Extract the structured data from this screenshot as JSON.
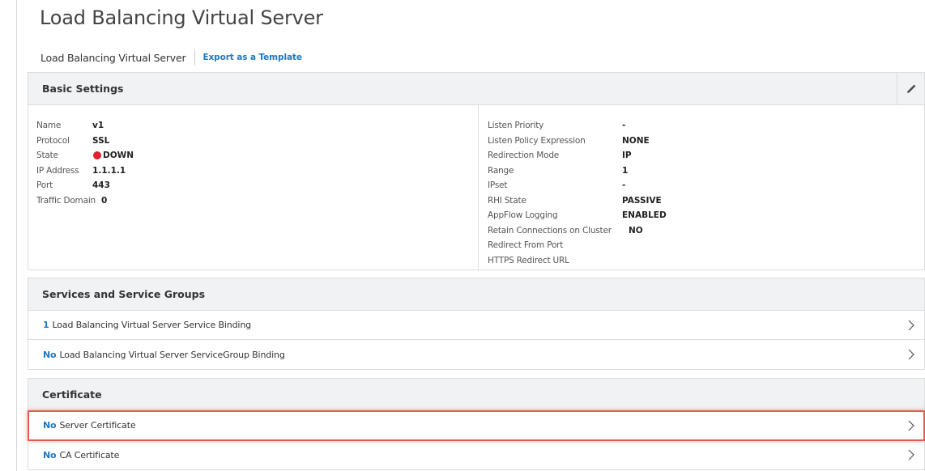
{
  "page": {
    "title": "Load Balancing Virtual Server"
  },
  "subheader": {
    "title": "Load Balancing Virtual Server",
    "export_link": "Export as a Template"
  },
  "basic_settings": {
    "header": "Basic Settings",
    "left": [
      {
        "key": "Name",
        "value": "v1"
      },
      {
        "key": "Protocol",
        "value": "SSL"
      },
      {
        "key": "State",
        "value": "DOWN",
        "status_color": "#e0202a"
      },
      {
        "key": "IP Address",
        "value": "1.1.1.1"
      },
      {
        "key": "Port",
        "value": "443"
      },
      {
        "key": "Traffic Domain",
        "value": "0"
      }
    ],
    "right": [
      {
        "key": "Listen Priority",
        "value": "-"
      },
      {
        "key": "Listen Policy Expression",
        "value": "NONE"
      },
      {
        "key": "Redirection Mode",
        "value": "IP"
      },
      {
        "key": "Range",
        "value": "1"
      },
      {
        "key": "IPset",
        "value": "-"
      },
      {
        "key": "RHI State",
        "value": "PASSIVE"
      },
      {
        "key": "AppFlow Logging",
        "value": "ENABLED"
      },
      {
        "key": "Retain Connections on Cluster",
        "value": "NO"
      },
      {
        "key": "Redirect From Port",
        "value": ""
      },
      {
        "key": "HTTPS Redirect URL",
        "value": ""
      }
    ]
  },
  "services": {
    "header": "Services and Service Groups",
    "rows": [
      {
        "count": "1",
        "label": "Load Balancing Virtual Server Service Binding"
      },
      {
        "count": "No",
        "label": "Load Balancing Virtual Server ServiceGroup Binding"
      }
    ]
  },
  "certificate": {
    "header": "Certificate",
    "rows": [
      {
        "count": "No",
        "label": "Server Certificate",
        "highlighted": true
      },
      {
        "count": "No",
        "label": "CA Certificate"
      }
    ]
  },
  "colors": {
    "link": "#2178bf",
    "status_down": "#e0202a",
    "highlight": "#e15f4e",
    "header_bg": "#f0f2f4"
  },
  "icons": {
    "edit": "pencil-icon",
    "row_nav": "chevron-right-icon"
  }
}
